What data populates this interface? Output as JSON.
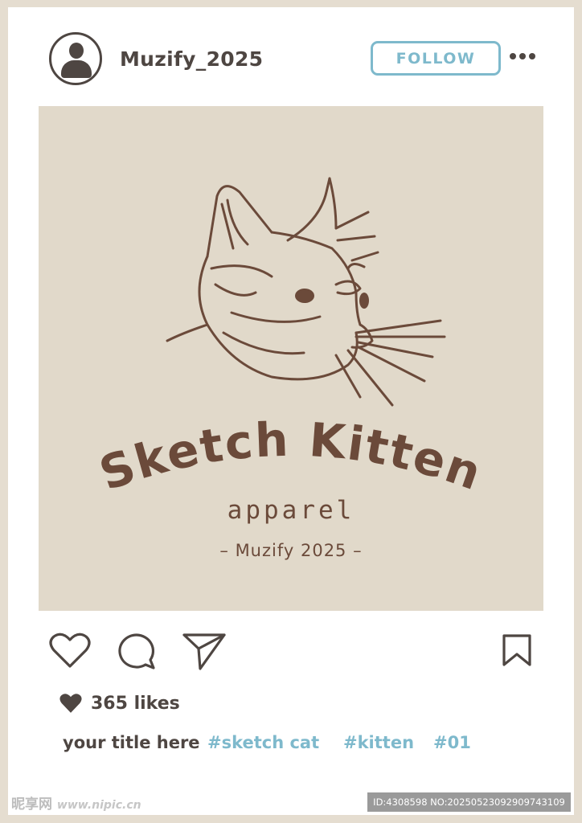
{
  "post": {
    "username": "Muzify_2025",
    "follow_label": "FOLLOW",
    "likes": "365 likes",
    "caption_title": "your title here",
    "hashtags": [
      "#sketch cat",
      "#kitten",
      "#01"
    ]
  },
  "image": {
    "brand_title": "Sketch Kitten",
    "brand_subtitle": "apparel",
    "brand_credit": "– Muzify 2025 –"
  },
  "watermark": {
    "site_name": "昵享网",
    "site_url": "www.nipic.cn",
    "id_text": "ID:4308598 NO:20250523092909743109"
  },
  "icons": {
    "avatar": "user-avatar-icon",
    "more": "more-horizontal-icon",
    "like": "heart-outline-icon",
    "comment": "comment-bubble-icon",
    "share": "paper-plane-icon",
    "save": "bookmark-icon",
    "likes_heart": "heart-filled-icon"
  },
  "colors": {
    "text_dark": "#4e4642",
    "accent_blue": "#7eb9cc",
    "image_bg": "#e1d9ca",
    "sketch_brown": "#6b4a3a",
    "frame": "#e5ddd0"
  }
}
